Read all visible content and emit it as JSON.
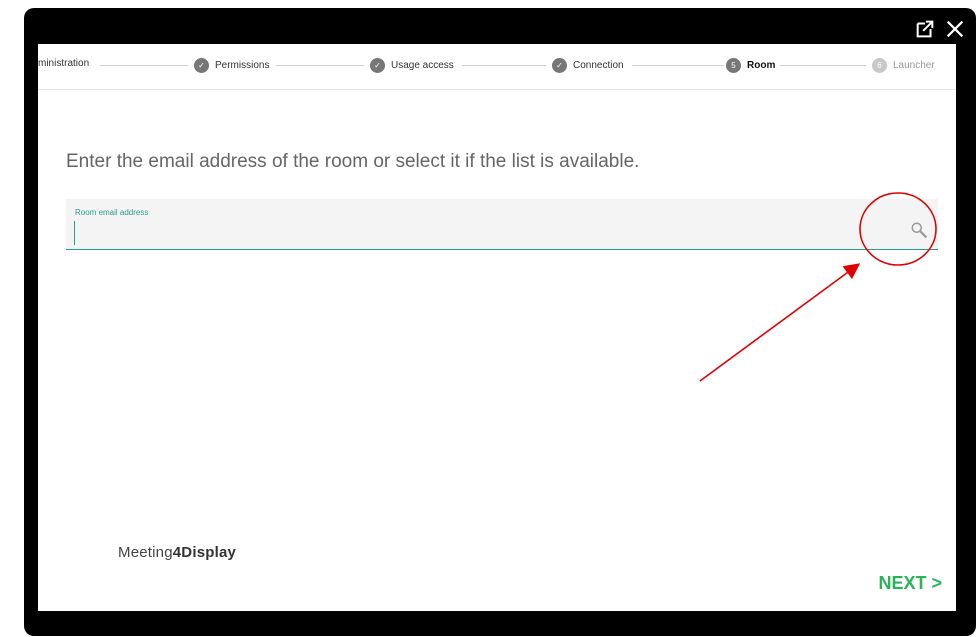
{
  "stepper": {
    "steps": [
      {
        "label": "ministration",
        "state": "done"
      },
      {
        "label": "Permissions",
        "state": "done"
      },
      {
        "label": "Usage access",
        "state": "done"
      },
      {
        "label": "Connection",
        "state": "done"
      },
      {
        "number": "5",
        "label": "Room",
        "state": "current"
      },
      {
        "number": "6",
        "label": "Launcher",
        "state": "pending"
      }
    ]
  },
  "main": {
    "prompt": "Enter the email address of the room or select it if the list is available.",
    "room_field": {
      "label": "Room email address",
      "value": "",
      "placeholder": ""
    }
  },
  "brand": {
    "part1": "Meeting",
    "part2": "4Display"
  },
  "footer": {
    "next_label": "NEXT >"
  },
  "window_icons": [
    "external-link-icon",
    "close-icon"
  ],
  "colors": {
    "accent": "#2a9d8f",
    "next": "#2bb35a",
    "annotation": "#e00000"
  }
}
